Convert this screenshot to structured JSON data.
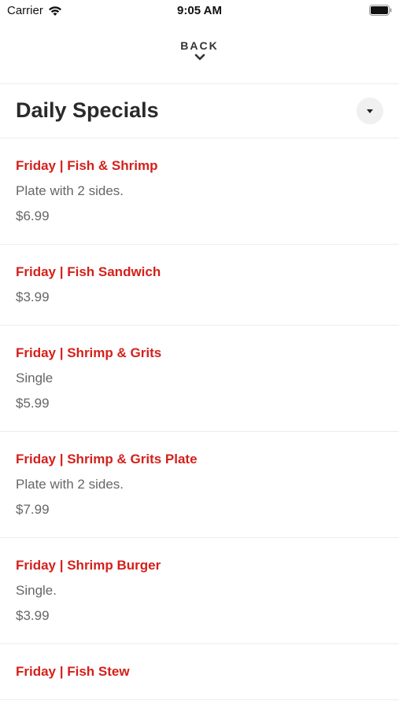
{
  "status_bar": {
    "carrier": "Carrier",
    "time": "9:05 AM"
  },
  "header": {
    "back_label": "BACK"
  },
  "section": {
    "title": "Daily Specials"
  },
  "items": [
    {
      "name": "Friday | Fish & Shrimp",
      "description": "Plate with 2 sides.",
      "price": "$6.99"
    },
    {
      "name": "Friday | Fish Sandwich",
      "description": "",
      "price": "$3.99"
    },
    {
      "name": "Friday | Shrimp & Grits",
      "description": "Single",
      "price": "$5.99"
    },
    {
      "name": "Friday | Shrimp & Grits Plate",
      "description": "Plate with 2 sides.",
      "price": "$7.99"
    },
    {
      "name": "Friday | Shrimp Burger",
      "description": "Single.",
      "price": "$3.99"
    },
    {
      "name": "Friday | Fish Stew",
      "description": "",
      "price": ""
    }
  ],
  "colors": {
    "accent": "#d4201b",
    "text_secondary": "#666666",
    "divider": "#ececec"
  }
}
